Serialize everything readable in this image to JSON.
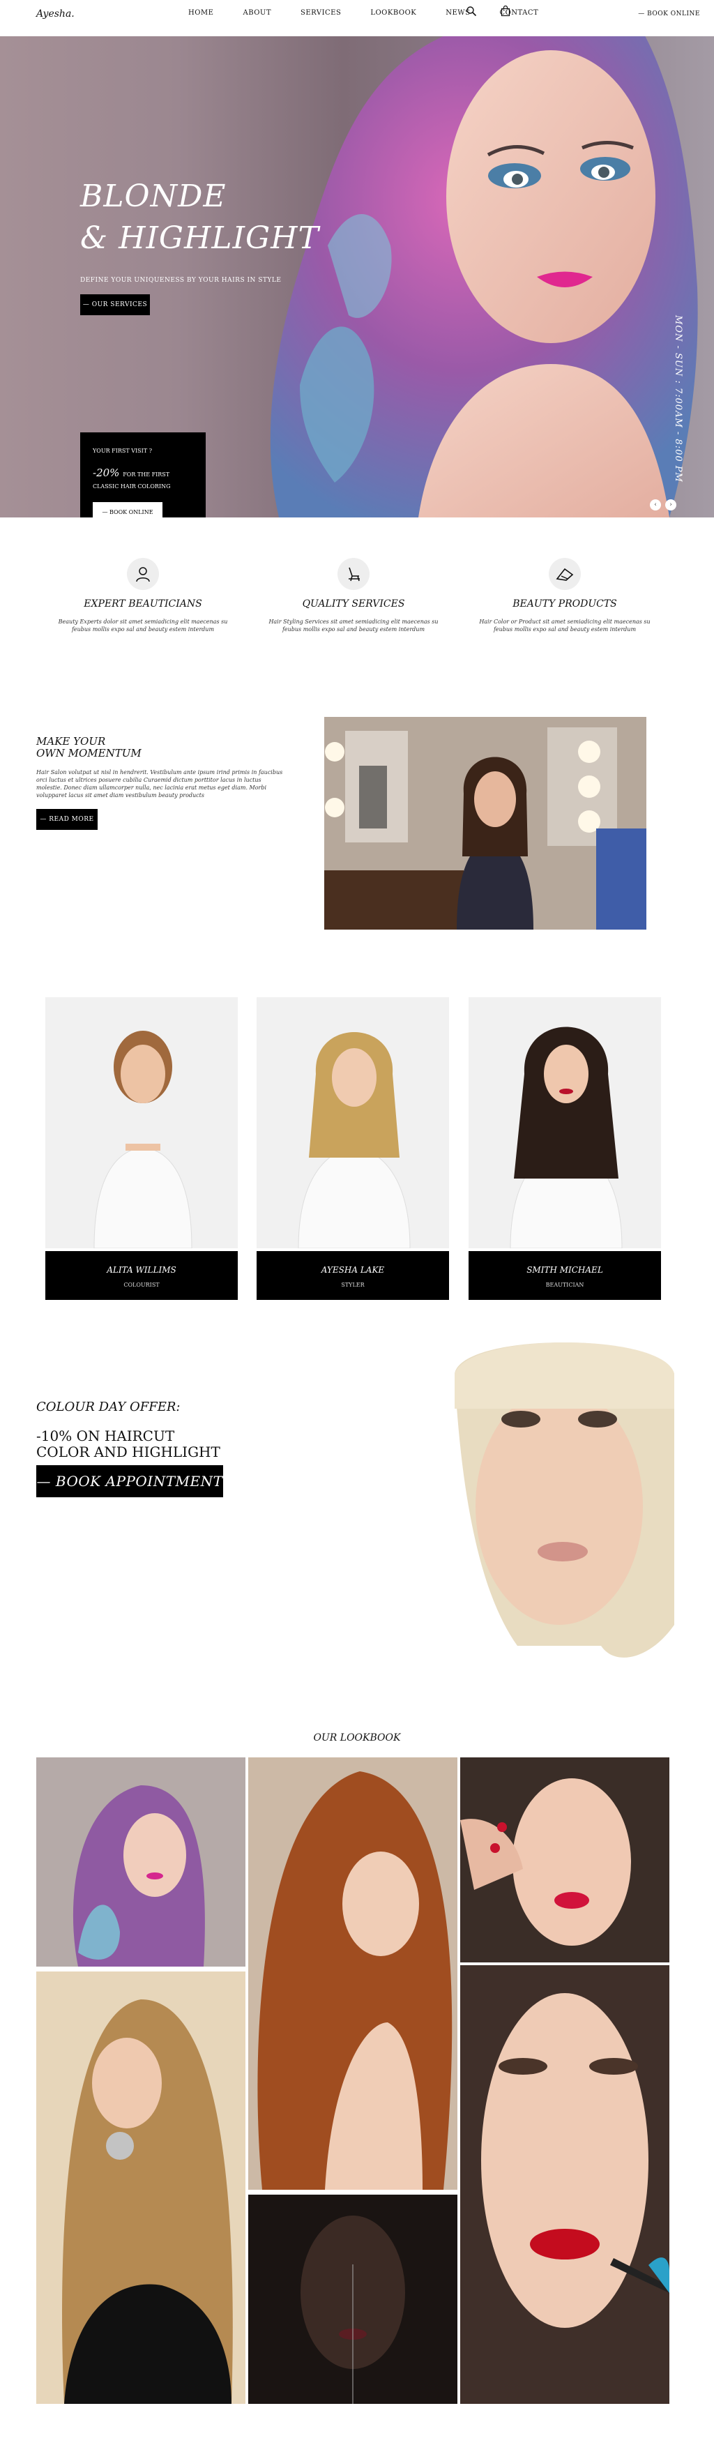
{
  "header": {
    "logo": "Ayesha.",
    "nav": [
      "HOME",
      "ABOUT",
      "SERVICES",
      "LOOKBOOK",
      "NEWS",
      "CONTACT"
    ],
    "book_online": "— BOOK ONLINE"
  },
  "hero": {
    "title_line1": "BLONDE",
    "title_line2": "& HIGHLIGHT",
    "subtitle": "DEFINE YOUR UNIQUENESS BY YOUR HAIRS IN STYLE",
    "services_button": "— OUR SERVICES",
    "offer": {
      "first_visit": "YOUR FIRST VISIT ?",
      "discount": "-20%",
      "for_the_first": "FOR THE FIRST",
      "classic": "CLASSIC HAIR COLORING",
      "book_button": "— BOOK ONLINE"
    },
    "hours": "MON - SUN : 7:00AM - 8:00 PM"
  },
  "features": [
    {
      "title": "EXPERT BEAUTICIANS",
      "text": "Beauty Experts dolor sit amet semiadicing elit maecenas su feubus mollis expo sal and beauty estem interdum"
    },
    {
      "title": "QUALITY SERVICES",
      "text": "Hair Styling Services sit amet semiadicing elit maecenas su feubus mollis expo sal and beauty estem interdum"
    },
    {
      "title": "BEAUTY PRODUCTS",
      "text": "Hair Color or Product sit amet semiadicing elit maecenas su feubus mollis expo sal and beauty estem interdum"
    }
  ],
  "momentum": {
    "title_line1": "MAKE YOUR",
    "title_line2": "OWN MOMENTUM",
    "text": "Hair Salon volutpat ut nisl in hendrerit. Vestibulum ante ipsum irind primis in faucibus orci luctus et ultrices posuere cubilia Curaemid dictum porttitor lacus in luctus molestie. Donec diam ullamcorper nulla, nec lacinia erat metus eget diam. Morbi volupparet lacus sit amet diam vestibulum beauty products",
    "button": "— READ MORE"
  },
  "team": [
    {
      "name": "ALITA WILLIMS",
      "role": "COLOURIST"
    },
    {
      "name": "Ayesha Lake",
      "role": "STYLER"
    },
    {
      "name": "Smith Michael",
      "role": "BEAUTICIAN"
    }
  ],
  "colour_day": {
    "heading": "COLOUR DAY OFFER:",
    "line1": "-10% ON HAIRCUT",
    "line2": "COLOR AND HIGHLIGHT",
    "button": "— BOOK APPOINTMENT"
  },
  "lookbook": {
    "title": "OUR LOOKBOOK"
  },
  "colors": {
    "accent": "#000000",
    "background": "#ffffff"
  }
}
